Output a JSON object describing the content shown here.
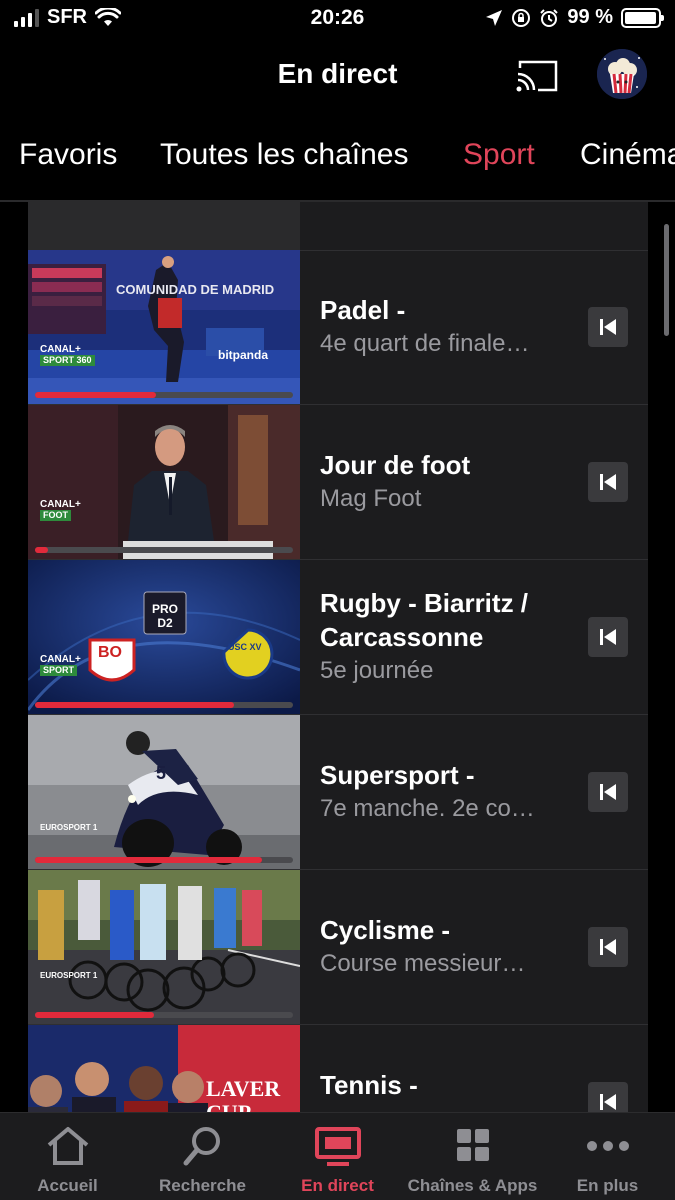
{
  "status_bar": {
    "carrier": "SFR",
    "time": "20:26",
    "battery_percent": "99 %"
  },
  "header": {
    "title": "En direct"
  },
  "tabs": [
    "Favoris",
    "Toutes les chaînes",
    "Sport",
    "Cinéma"
  ],
  "active_tab": "Sport",
  "programs": [
    {
      "title": "Padel -",
      "subtitle": "4e quart de finale…",
      "channel": "CANAL+ SPORT 360",
      "progress": 0.47
    },
    {
      "title": "Jour de foot",
      "subtitle": "Mag Foot",
      "channel": "CANAL+ FOOT",
      "progress": 0.05
    },
    {
      "title": "Rugby - Biarritz / Carcassonne",
      "subtitle": "5e journée",
      "channel": "CANAL+ SPORT",
      "progress": 0.77
    },
    {
      "title": "Supersport -",
      "subtitle": "7e manche. 2e co…",
      "channel": "EUROSPORT 1",
      "progress": 0.88
    },
    {
      "title": "Cyclisme -",
      "subtitle": "Course messieur…",
      "channel": "EUROSPORT 1",
      "progress": 0.46
    },
    {
      "title": "Tennis -",
      "subtitle": "",
      "channel": "",
      "progress": 0
    }
  ],
  "thumbnail_text": {
    "padel_banner": "COMUNIDAD DE MADRID",
    "padel_sponsor": "bitpanda",
    "rugby_league": "PRO D2",
    "rugby_team_1": "BO",
    "rugby_team_2": "USC XV",
    "tennis_event": "LAVER CUP"
  },
  "bottom_nav": [
    {
      "label": "Accueil",
      "icon": "home-icon"
    },
    {
      "label": "Recherche",
      "icon": "search-icon"
    },
    {
      "label": "En direct",
      "icon": "tv-icon"
    },
    {
      "label": "Chaînes & Apps",
      "icon": "grid-icon"
    },
    {
      "label": "En plus",
      "icon": "more-icon"
    }
  ],
  "active_nav": "En direct",
  "colors": {
    "accent": "#e0455a",
    "progress": "#e22a3b",
    "background": "#000000",
    "surface": "#1c1c1e",
    "muted_text": "#9a9a9f"
  }
}
